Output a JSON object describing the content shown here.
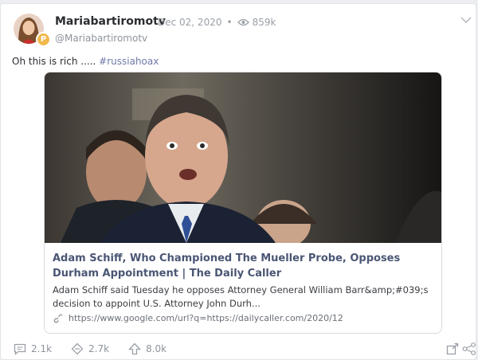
{
  "post": {
    "author_name": "Mariabartiromotv",
    "date": "Dec 02, 2020",
    "separator": "•",
    "views": "859k",
    "handle": "@Mariabartiromotv",
    "badge_letter": "P",
    "text_before": "Oh this is rich ..... ",
    "hashtag": "#russiahoax"
  },
  "link_card": {
    "title": "Adam Schiff, Who Championed The Mueller Probe, Opposes Durham Appointment | The Daily Caller",
    "description": "Adam Schiff said Tuesday he opposes Attorney General William Barr&amp;#039;s decision to appoint U.S. Attorney John Durh...",
    "url": "https://www.google.com/url?q=https://dailycaller.com/2020/12"
  },
  "actions": {
    "replies": "2.1k",
    "reposts": "2.7k",
    "upvotes": "8.0k"
  },
  "icons": [
    "eye-icon",
    "chevron-down-icon",
    "link-icon",
    "comment-icon",
    "repost-icon",
    "upvote-icon",
    "quote-icon",
    "share-icon"
  ]
}
